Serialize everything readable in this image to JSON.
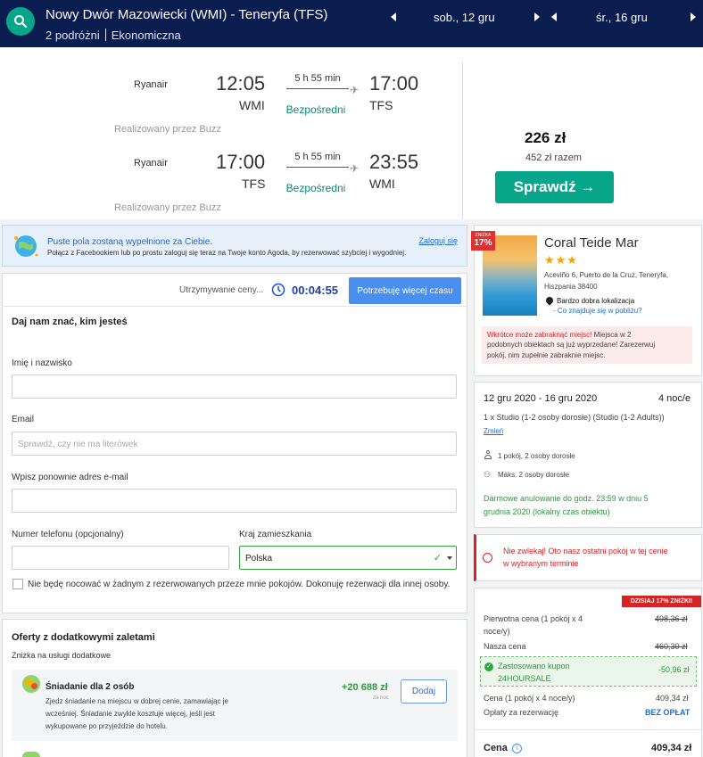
{
  "header": {
    "route": "Nowy Dwór Mazowiecki (WMI) - Teneryfa (TFS)",
    "travellers": "2 podróżni",
    "cabin": "Ekonomiczna",
    "date_out": "sob., 12 gru",
    "date_back": "śr., 16 gru"
  },
  "flights": [
    {
      "airline": "Ryanair",
      "dep_time": "12:05",
      "dep_code": "WMI",
      "duration": "5 h 55 min",
      "type": "Bezpośredni",
      "arr_time": "17:00",
      "arr_code": "TFS",
      "operated_by": "Realizowany przez Buzz"
    },
    {
      "airline": "Ryanair",
      "dep_time": "17:00",
      "dep_code": "TFS",
      "duration": "5 h 55 min",
      "type": "Bezpośredni",
      "arr_time": "23:55",
      "arr_code": "WMI",
      "operated_by": "Realizowany przez Buzz"
    }
  ],
  "price": {
    "per_person": "226 zł",
    "total": "452 zł razem",
    "check_label": "Sprawdź →"
  },
  "facebook": {
    "title": "Puste pola zostaną wypełnione za Ciebie.",
    "desc": "Połącz z Facebookiem lub po prostu zaloguj się teraz na Twoje konto Agoda, by rezerwować szybciej i wygodniej.",
    "login": "Zaloguj się"
  },
  "form": {
    "hold_label": "Utrzymywanie ceny...",
    "timer": "00:04:55",
    "more_time": "Potrzebuję więcej czasu",
    "heading": "Daj nam znać, kim jesteś",
    "name_label": "Imię i nazwisko",
    "email_label": "Email",
    "email_placeholder": "Sprawdź, czy nie ma literówek",
    "email2_label": "Wpisz ponownie adres e-mail",
    "phone_label": "Numer telefonu (opcjonalny)",
    "country_label": "Kraj zamieszkania",
    "country_value": "Polska",
    "checkbox_label": "Nie będę nocować w żadnym z rezerwowanych przeze mnie pokojów. Dokonuję rezerwacji dla innej osoby."
  },
  "offers": {
    "heading": "Oferty z dodatkowymi zaletami",
    "sub": "Zniżka na usługi dodatkowe",
    "item_title": "Śniadanie dla 2 osób",
    "item_desc1": "Zjedz śniadanie na miejscu w dobrej cenie, zamawiając je",
    "item_desc2": "wcześniej. Śniadanie zwykle kosztuje więcej, jeśli jest",
    "item_desc3": "wykupowane po przyjeździe do hotelu.",
    "item_price": "+20 688 zł",
    "item_per": "za noc",
    "add_label": "Dodaj"
  },
  "hotel": {
    "badge_top": "ZNIŻKA",
    "badge_pct": "17%",
    "name": "Coral Teide Mar",
    "stars": "★★★",
    "addr1": "Aceviño 6, Puerto de la Cruz, Teneryfa,",
    "addr2": "Hiszpania 38400",
    "location": "Bardzo dobra lokalizacja",
    "nearby": "- Co znajduje się w pobliżu?",
    "warn_title": "Wkrótce może zabraknąć miejsc!",
    "warn_text1": "Miejsca w 2",
    "warn_text2": "podobnych obiektach są już wyprzedane! Zarezerwuj",
    "warn_text3": "pokój, nim zupełnie zabraknie miejsc."
  },
  "stay": {
    "dates": "12 gru 2020 - 16 gru 2020",
    "nights": "4 noc/e",
    "room": "1 x Studio (1-2 osoby dorosłe) (Studio (1-2 Adults))",
    "change": "Zmień",
    "rooms": "1 pokój, 2 osoby dorosłe",
    "max": "Maks. 2 osoby dorosłe",
    "cancel1": "Darmowe anulowanie do godz. 23:59 w dniu 5",
    "cancel2": "grudnia 2020 (lokalny czas obiektu)"
  },
  "urgent": {
    "line1": "Nie zwlekaj! Oto nasz ostatni pokój w tej cenie",
    "line2": "w wybranym terminie"
  },
  "pricing": {
    "badge": "DZISIAJ 17% ZNIŻKI!",
    "orig_label1": "Pierwotna cena (1 pokój x 4",
    "orig_label2": "noce/y)",
    "orig_value": "498,36 zł",
    "our_label": "Nasza cena",
    "our_value": "460,30 zł",
    "coupon_label": "Zastosowano kupon",
    "coupon_code": "24HOURSALE",
    "coupon_value": "-50,96 zł",
    "room_label": "Cena (1 pokój x 4 noce/y)",
    "room_value": "409,34 zł",
    "fee_label": "Opłaty za rezerwację",
    "fee_value": "BEZ OPŁAT",
    "total_label": "Cena",
    "total_value": "409,34 zł"
  },
  "colors": {
    "navy": "#0b1c4f",
    "teal": "#07a68b",
    "blue": "#1e6bd6",
    "red": "#d42426",
    "green": "#2a9a3c"
  }
}
